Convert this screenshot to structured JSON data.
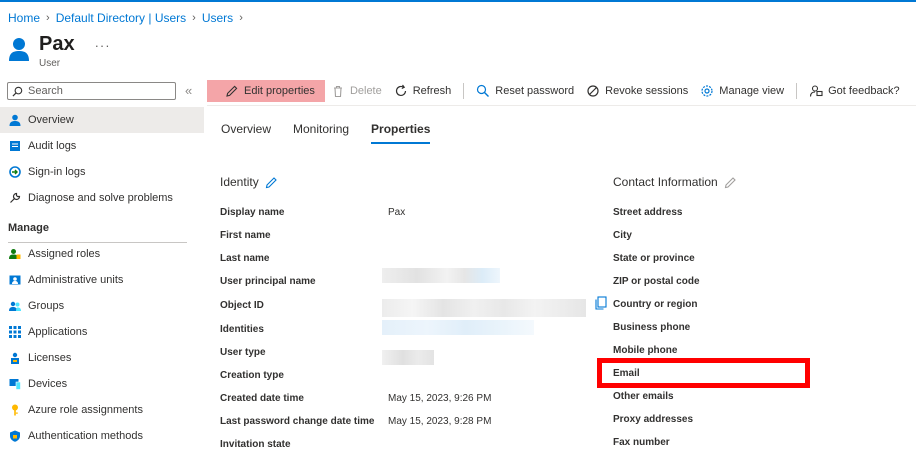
{
  "breadcrumb": [
    "Home",
    "Default Directory | Users",
    "Users"
  ],
  "header": {
    "title": "Pax",
    "subtitle": "User",
    "more": "···"
  },
  "search": {
    "placeholder": "Search"
  },
  "sidebar": {
    "items": [
      {
        "label": "Overview",
        "icon": "user-icon",
        "active": true
      },
      {
        "label": "Audit logs",
        "icon": "audit-logs-icon"
      },
      {
        "label": "Sign-in logs",
        "icon": "sign-in-icon"
      },
      {
        "label": "Diagnose and solve problems",
        "icon": "wrench-icon"
      }
    ],
    "section": "Manage",
    "manage_items": [
      {
        "label": "Assigned roles",
        "icon": "roles-icon"
      },
      {
        "label": "Administrative units",
        "icon": "admin-units-icon"
      },
      {
        "label": "Groups",
        "icon": "groups-icon"
      },
      {
        "label": "Applications",
        "icon": "apps-grid-icon"
      },
      {
        "label": "Licenses",
        "icon": "license-icon"
      },
      {
        "label": "Devices",
        "icon": "devices-icon"
      },
      {
        "label": "Azure role assignments",
        "icon": "key-icon"
      },
      {
        "label": "Authentication methods",
        "icon": "shield-icon"
      }
    ]
  },
  "toolbar": {
    "edit": "Edit properties",
    "delete": "Delete",
    "refresh": "Refresh",
    "reset_password": "Reset password",
    "revoke_sessions": "Revoke sessions",
    "manage_view": "Manage view",
    "feedback": "Got feedback?"
  },
  "tabs": [
    "Overview",
    "Monitoring",
    "Properties"
  ],
  "identity": {
    "title": "Identity",
    "labels": [
      "Display name",
      "First name",
      "Last name",
      "User principal name",
      "Object ID",
      "Identities",
      "User type",
      "Creation type",
      "Created date time",
      "Last password change date time",
      "Invitation state"
    ],
    "values": [
      "Pax",
      "",
      "",
      "",
      "",
      "",
      "",
      "",
      "May 15, 2023, 9:26 PM",
      "May 15, 2023, 9:28 PM",
      ""
    ]
  },
  "contact": {
    "title": "Contact Information",
    "labels": [
      "Street address",
      "City",
      "State or province",
      "ZIP or postal code",
      "Country or region",
      "Business phone",
      "Mobile phone",
      "Email",
      "Other emails",
      "Proxy addresses",
      "Fax number"
    ]
  },
  "colors": {
    "accent": "#0078d4",
    "highlight": "#ff0000",
    "edit_bg": "#f4a5a8"
  }
}
